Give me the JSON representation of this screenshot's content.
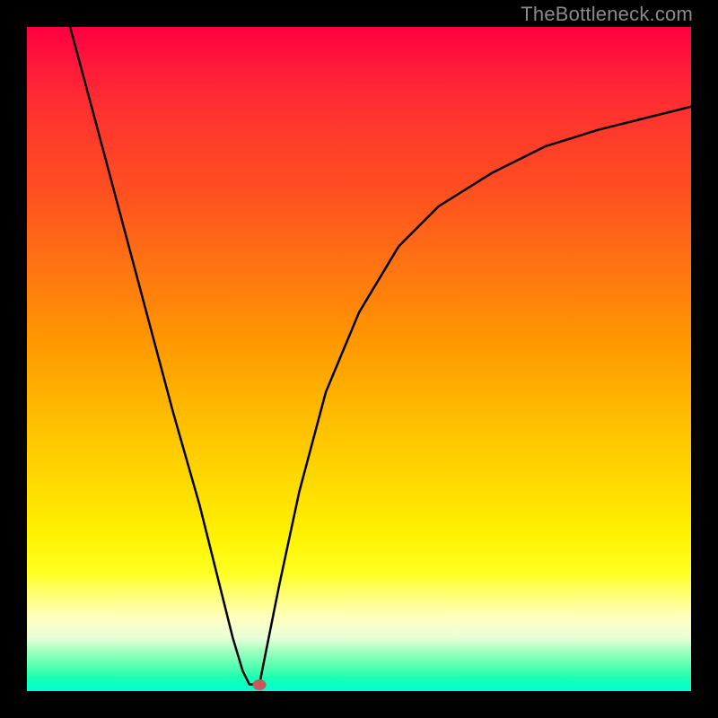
{
  "watermark": "TheBottleneck.com",
  "chart_data": {
    "type": "line",
    "title": "",
    "xlabel": "",
    "ylabel": "",
    "xlim": [
      0,
      100
    ],
    "ylim": [
      0,
      100
    ],
    "grid": false,
    "legend": false,
    "series": [
      {
        "name": "curve-left",
        "x": [
          6.5,
          10,
          14,
          18,
          22,
          26,
          29,
          31,
          32.5,
          33.5
        ],
        "y": [
          100,
          87,
          72,
          57,
          42,
          28,
          16,
          8,
          3,
          1
        ]
      },
      {
        "name": "curve-bottom",
        "x": [
          33.5,
          35.0
        ],
        "y": [
          1,
          1
        ]
      },
      {
        "name": "curve-right",
        "x": [
          35,
          36,
          38,
          41,
          45,
          50,
          56,
          62,
          70,
          78,
          86,
          94,
          100
        ],
        "y": [
          1,
          6,
          16,
          30,
          45,
          57,
          67,
          73,
          78,
          82,
          84.5,
          86.5,
          88
        ]
      }
    ],
    "marker": {
      "x": 35,
      "y": 1,
      "color": "#c45a5a"
    },
    "gradient_colors": {
      "top": "#ff0040",
      "mid_upper": "#ff7a10",
      "mid": "#ffd800",
      "mid_lower": "#ffff20",
      "bottom": "#00ffcf"
    }
  }
}
